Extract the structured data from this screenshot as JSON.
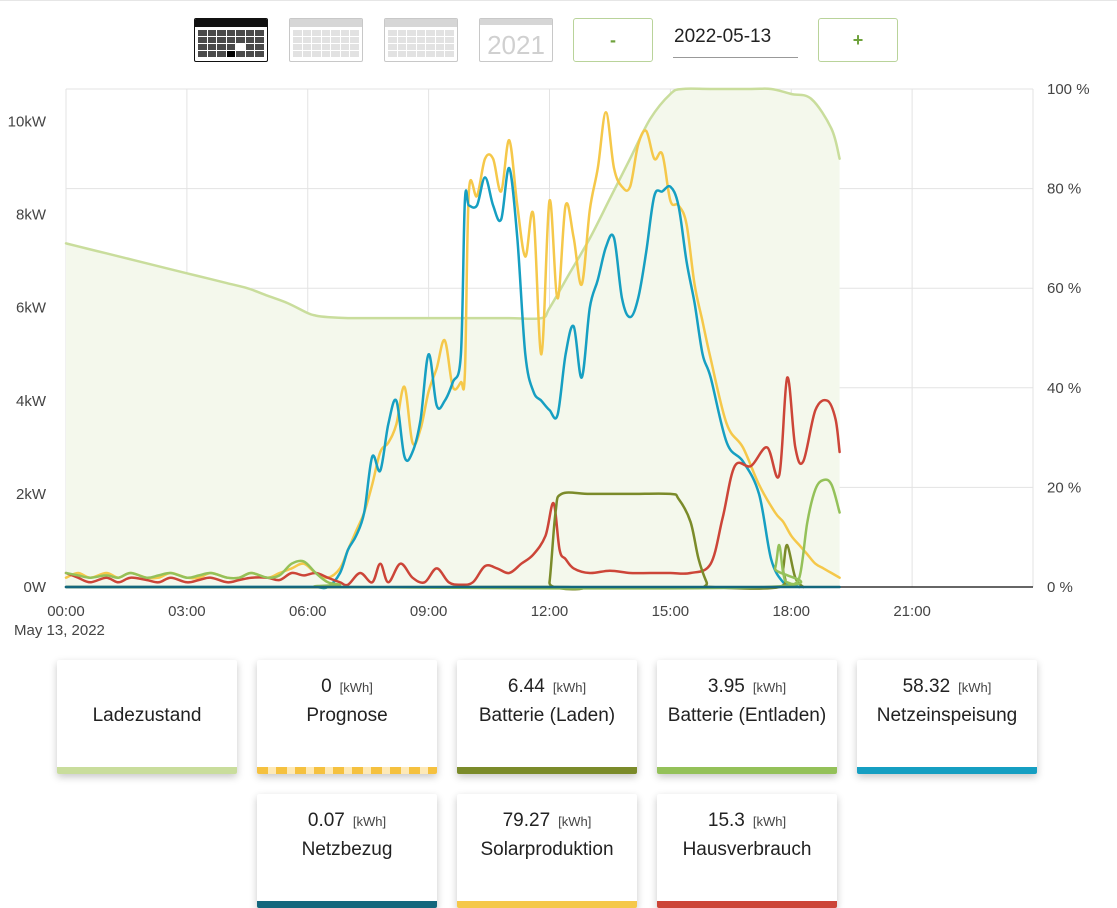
{
  "toolbar": {
    "views": [
      {
        "name": "day-view",
        "active": true
      },
      {
        "name": "week-view",
        "active": false
      },
      {
        "name": "month-view",
        "active": false
      },
      {
        "name": "year-view",
        "active": false,
        "label": "2021"
      }
    ],
    "minus_label": "-",
    "date": "2022-05-13",
    "plus_label": "+"
  },
  "colors": {
    "ladezustand": "#c9dd9c",
    "prognose": "#f5c13f",
    "batterie_laden": "#7b8b2a",
    "batterie_entladen": "#94c159",
    "netzeinspeisung": "#169fc2",
    "netzbezug": "#14677d",
    "solarproduktion": "#f5c84a",
    "hausverbrauch": "#cc4538"
  },
  "chart_data": {
    "type": "line",
    "x_unit": "hour",
    "xlim": [
      0,
      24
    ],
    "x_ticks": [
      "00:00",
      "03:00",
      "06:00",
      "09:00",
      "12:00",
      "15:00",
      "18:00",
      "21:00"
    ],
    "x_date_label": "May 13, 2022",
    "y_left_ticks": [
      "0W",
      "2kW",
      "4kW",
      "6kW",
      "8kW",
      "10kW"
    ],
    "y_left_lim": [
      0,
      10.7
    ],
    "y_left_unit": "kW",
    "y_right_ticks": [
      "0 %",
      "20 %",
      "40 %",
      "60 %",
      "80 %",
      "100 %"
    ],
    "y_right_lim": [
      0,
      100
    ],
    "grid": true,
    "series": [
      {
        "key": "ladezustand",
        "axis": "right",
        "fill": true,
        "x": [
          0,
          0.5,
          1,
          1.5,
          2,
          2.5,
          3,
          3.5,
          4,
          4.5,
          5,
          5.5,
          6,
          6.2,
          6.5,
          7,
          8,
          9,
          10,
          11,
          11.8,
          12,
          12.5,
          13,
          13.5,
          14,
          14.5,
          15,
          15.3,
          16,
          17,
          17.5,
          18,
          18.5,
          19,
          19.2
        ],
        "y": [
          69,
          68,
          67,
          66,
          65,
          64,
          63,
          62,
          61,
          60,
          58.5,
          57,
          55,
          54.5,
          54.2,
          54,
          54,
          54,
          54,
          54,
          54,
          56,
          63,
          70,
          78,
          86,
          94,
          99,
          100,
          100,
          100,
          100,
          99,
          98,
          92,
          86
        ]
      },
      {
        "key": "solarproduktion",
        "axis": "left",
        "x": [
          0,
          0.3,
          0.6,
          1,
          1.3,
          1.6,
          2,
          2.3,
          2.6,
          3,
          3.3,
          3.6,
          4,
          4.3,
          4.6,
          5,
          5.3,
          5.6,
          5.9,
          6.2,
          6.5,
          6.8,
          7,
          7.2,
          7.4,
          7.6,
          7.8,
          8,
          8.2,
          8.4,
          8.6,
          8.8,
          9,
          9.2,
          9.4,
          9.6,
          9.8,
          9.9,
          10,
          10.2,
          10.4,
          10.6,
          10.8,
          11,
          11.2,
          11.4,
          11.6,
          11.8,
          12,
          12.2,
          12.4,
          12.6,
          12.8,
          13,
          13.2,
          13.4,
          13.6,
          13.8,
          14,
          14.2,
          14.4,
          14.6,
          14.8,
          15,
          15.2,
          15.4,
          15.6,
          15.8,
          16,
          16.4,
          16.8,
          17.2,
          17.6,
          17.8,
          18,
          18.2,
          18.4,
          18.6,
          18.8,
          19,
          19.2
        ],
        "y": [
          0.2,
          0.3,
          0.2,
          0.3,
          0.2,
          0.3,
          0.2,
          0.2,
          0.3,
          0.2,
          0.2,
          0.3,
          0.2,
          0.2,
          0.3,
          0.2,
          0.3,
          0.4,
          0.5,
          0.3,
          0.2,
          0.4,
          0.8,
          1.2,
          1.6,
          2.2,
          2.9,
          3.1,
          3.5,
          4.3,
          3.1,
          3.4,
          4.2,
          4.7,
          5.3,
          4.3,
          4.4,
          4.6,
          8.5,
          8.4,
          9.2,
          9.2,
          8.5,
          9.6,
          8.2,
          7.1,
          8.0,
          5.0,
          8.3,
          6.2,
          8.2,
          7.5,
          6.5,
          8.1,
          9.0,
          10.2,
          9.0,
          8.6,
          8.6,
          9.5,
          9.8,
          9.2,
          9.3,
          8.3,
          8.2,
          7.8,
          6.5,
          5.7,
          4.9,
          3.5,
          3.0,
          2.2,
          1.6,
          1.4,
          1.1,
          0.9,
          0.7,
          0.5,
          0.4,
          0.3,
          0.2
        ]
      },
      {
        "key": "netzeinspeisung",
        "axis": "left",
        "x": [
          0,
          0.3,
          0.6,
          1,
          1.3,
          1.6,
          2,
          2.3,
          2.6,
          3,
          3.3,
          3.6,
          4,
          4.3,
          4.6,
          5,
          5.3,
          5.6,
          5.9,
          6.2,
          6.5,
          6.8,
          7,
          7.2,
          7.4,
          7.6,
          7.8,
          8,
          8.2,
          8.4,
          8.6,
          8.8,
          9,
          9.2,
          9.4,
          9.6,
          9.8,
          9.9,
          10,
          10.2,
          10.4,
          10.6,
          10.8,
          11,
          11.2,
          11.4,
          11.6,
          11.8,
          12,
          12.2,
          12.4,
          12.6,
          12.8,
          13,
          13.2,
          13.4,
          13.6,
          13.8,
          14,
          14.2,
          14.4,
          14.6,
          14.8,
          15,
          15.2,
          15.4,
          15.6,
          15.8,
          16,
          16.4,
          16.8,
          17.2,
          17.5,
          17.8,
          18,
          18.2
        ],
        "y": [
          0,
          0,
          0,
          0,
          0,
          0,
          0,
          0,
          0,
          0,
          0,
          0,
          0,
          0,
          0,
          0,
          0,
          0,
          0,
          0,
          0,
          0.3,
          0.8,
          1.1,
          1.6,
          2.8,
          2.5,
          3.5,
          4.0,
          2.8,
          2.9,
          3.6,
          5.0,
          3.9,
          4.0,
          4.4,
          5.0,
          8.3,
          8.2,
          8.2,
          8.8,
          8.2,
          7.9,
          9.0,
          7.5,
          5.0,
          4.2,
          4.0,
          3.8,
          3.7,
          5.0,
          5.6,
          4.5,
          6.0,
          6.6,
          7.3,
          7.5,
          6.2,
          5.8,
          6.2,
          7.2,
          8.4,
          8.5,
          8.6,
          8.2,
          7.0,
          6.1,
          5.0,
          4.5,
          3.1,
          2.7,
          2.0,
          0.6,
          0.1,
          0.05,
          0
        ]
      },
      {
        "key": "hausverbrauch",
        "axis": "left",
        "x": [
          0,
          0.3,
          0.6,
          1,
          1.3,
          1.6,
          2,
          2.3,
          2.6,
          3,
          3.3,
          3.6,
          4,
          4.3,
          4.6,
          5,
          5.3,
          5.6,
          5.9,
          6.2,
          6.5,
          6.8,
          7,
          7.3,
          7.6,
          7.8,
          8.0,
          8.3,
          8.6,
          8.9,
          9.2,
          9.5,
          9.8,
          10.1,
          10.4,
          10.7,
          11.0,
          11.3,
          11.6,
          11.9,
          12.1,
          12.25,
          12.4,
          12.6,
          13,
          13.5,
          14,
          14.5,
          15,
          15.5,
          16,
          16.3,
          16.6,
          17,
          17.4,
          17.7,
          17.9,
          18.1,
          18.3,
          18.6,
          18.9,
          19.1,
          19.2
        ],
        "y": [
          0.3,
          0.2,
          0.1,
          0.2,
          0.1,
          0.2,
          0.15,
          0.1,
          0.2,
          0.1,
          0.15,
          0.2,
          0.1,
          0.15,
          0.2,
          0.2,
          0.15,
          0.3,
          0.25,
          0.3,
          0.2,
          0.1,
          0.05,
          0.3,
          0.1,
          0.5,
          0.1,
          0.5,
          0.2,
          0.1,
          0.4,
          0.1,
          0.05,
          0.1,
          0.45,
          0.4,
          0.3,
          0.5,
          0.7,
          1.1,
          1.8,
          0.8,
          0.6,
          0.4,
          0.3,
          0.35,
          0.3,
          0.3,
          0.3,
          0.3,
          0.5,
          1.5,
          2.6,
          2.6,
          3.0,
          2.4,
          4.5,
          3.0,
          2.7,
          3.8,
          4.0,
          3.6,
          2.9
        ]
      },
      {
        "key": "batterie_laden",
        "axis": "left",
        "x": [
          0,
          11.9,
          12.0,
          12.15,
          12.3,
          13,
          14,
          15,
          15.2,
          15.5,
          15.7,
          15.9,
          16,
          17.7,
          17.8,
          17.9,
          18.1,
          18.3
        ],
        "y": [
          0,
          0,
          0.1,
          1.6,
          2.0,
          2.0,
          2.0,
          2.0,
          1.9,
          1.4,
          0.6,
          0.1,
          0,
          0,
          0.4,
          0.9,
          0.2,
          0
        ]
      },
      {
        "key": "batterie_entladen",
        "axis": "left",
        "x": [
          0,
          0.3,
          0.6,
          1,
          1.3,
          1.6,
          2,
          2.3,
          2.6,
          3,
          3.3,
          3.6,
          4,
          4.3,
          4.6,
          5,
          5.3,
          5.6,
          5.9,
          6.2,
          6.5,
          6.8,
          7,
          17.4,
          17.6,
          17.7,
          17.8,
          17.9,
          18.2,
          18.4,
          18.6,
          18.8,
          19.0,
          19.2
        ],
        "y": [
          0.3,
          0.25,
          0.2,
          0.25,
          0.2,
          0.3,
          0.2,
          0.25,
          0.3,
          0.2,
          0.25,
          0.3,
          0.2,
          0.2,
          0.3,
          0.2,
          0.25,
          0.5,
          0.55,
          0.3,
          0.1,
          0.05,
          0,
          0,
          0.4,
          0.9,
          0.3,
          0.1,
          0.2,
          1.4,
          2.1,
          2.3,
          2.2,
          1.6
        ]
      },
      {
        "key": "netzbezug",
        "axis": "left",
        "x": [
          0,
          19.2
        ],
        "y": [
          0,
          0
        ]
      }
    ]
  },
  "cards": [
    {
      "key": "ladezustand",
      "value": "",
      "unit": "",
      "label": "Ladezustand"
    },
    {
      "key": "prognose",
      "value": "0",
      "unit": "[kWh]",
      "label": "Prognose"
    },
    {
      "key": "batterie_laden",
      "value": "6.44",
      "unit": "[kWh]",
      "label": "Batterie (Laden)"
    },
    {
      "key": "batterie_entladen",
      "value": "3.95",
      "unit": "[kWh]",
      "label": "Batterie (Entladen)"
    },
    {
      "key": "netzeinspeisung",
      "value": "58.32",
      "unit": "[kWh]",
      "label": "Netzeinspeisung"
    },
    {
      "key": "netzbezug",
      "value": "0.07",
      "unit": "[kWh]",
      "label": "Netzbezug"
    },
    {
      "key": "solarproduktion",
      "value": "79.27",
      "unit": "[kWh]",
      "label": "Solarproduktion"
    },
    {
      "key": "hausverbrauch",
      "value": "15.3",
      "unit": "[kWh]",
      "label": "Hausverbrauch"
    }
  ]
}
